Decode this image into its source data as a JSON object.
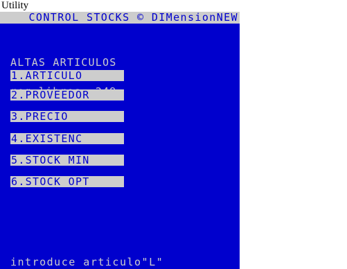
{
  "caption": "Utility",
  "screen": {
    "title": "CONTROL STOCKS © DIMensionNEW",
    "heading_line1": "ALTAS ARTICULOS",
    "heading_line2": "reg.libres, 249",
    "menu": [
      {
        "label": "1.ARTICULO"
      },
      {
        "label": "2.PROVEEDOR"
      },
      {
        "label": "3.PRECIO"
      },
      {
        "label": "4.EXISTENC"
      },
      {
        "label": "5.STOCK MIN"
      },
      {
        "label": "6.STOCK OPT"
      }
    ],
    "prompt": "introduce articulo\"L\""
  },
  "colors": {
    "screen_background": "#0000cd",
    "text": "#cdcdcd",
    "highlight_background": "#cdcdcd",
    "highlight_text": "#0000cd"
  }
}
